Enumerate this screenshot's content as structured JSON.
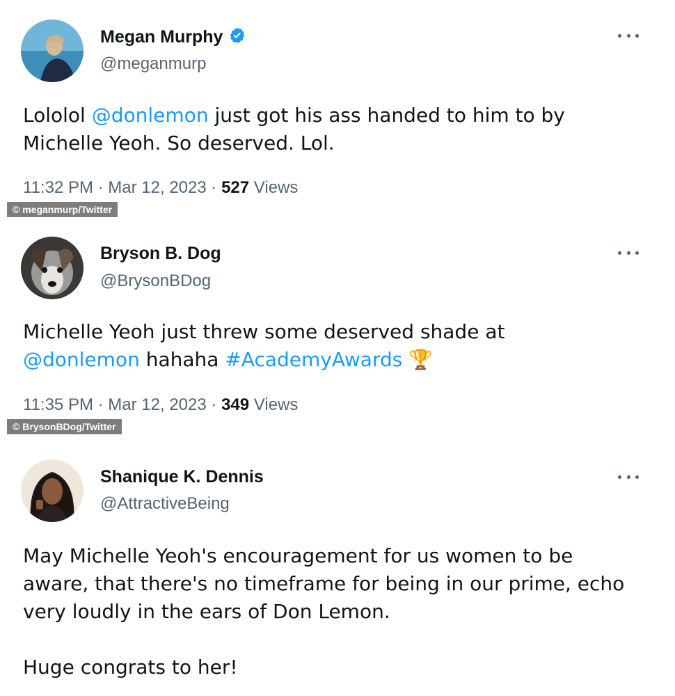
{
  "tweets": [
    {
      "name": "Megan Murphy",
      "verified": true,
      "handle": "@meganmurp",
      "body": [
        {
          "t": "Lololol ",
          "link": false
        },
        {
          "t": "@donlemon",
          "link": true
        },
        {
          "t": " just got his ass handed to him to by\nMichelle Yeoh. So deserved. Lol.",
          "link": false
        }
      ],
      "time": "11:32 PM",
      "sep": "·",
      "date": "Mar 12, 2023",
      "views_count": "527",
      "views_label": "Views",
      "credit": "© meganmurp/Twitter"
    },
    {
      "name": "Bryson B. Dog",
      "verified": false,
      "handle": "@BrysonBDog",
      "body": [
        {
          "t": "Michelle Yeoh just threw some deserved shade at\n",
          "link": false
        },
        {
          "t": "@donlemon",
          "link": true
        },
        {
          "t": " hahaha ",
          "link": false
        },
        {
          "t": "#AcademyAwards",
          "link": true
        },
        {
          "t": " 🏆",
          "link": false
        }
      ],
      "time": "11:35 PM",
      "sep": "·",
      "date": "Mar 12, 2023",
      "views_count": "349",
      "views_label": "Views",
      "credit": "© BrysonBDog/Twitter"
    },
    {
      "name": "Shanique K. Dennis",
      "verified": false,
      "handle": "@AttractiveBeing",
      "body": [
        {
          "t": "May Michelle Yeoh's encouragement for us women to be\naware, that there's no timeframe for being in our prime, echo\nvery loudly in the ears of Don Lemon.\n\nHuge congrats to her!",
          "link": false
        }
      ]
    }
  ],
  "colors": {
    "link": "#1d9bf0",
    "secondary": "#536471",
    "verified": "#1d9bf0"
  }
}
